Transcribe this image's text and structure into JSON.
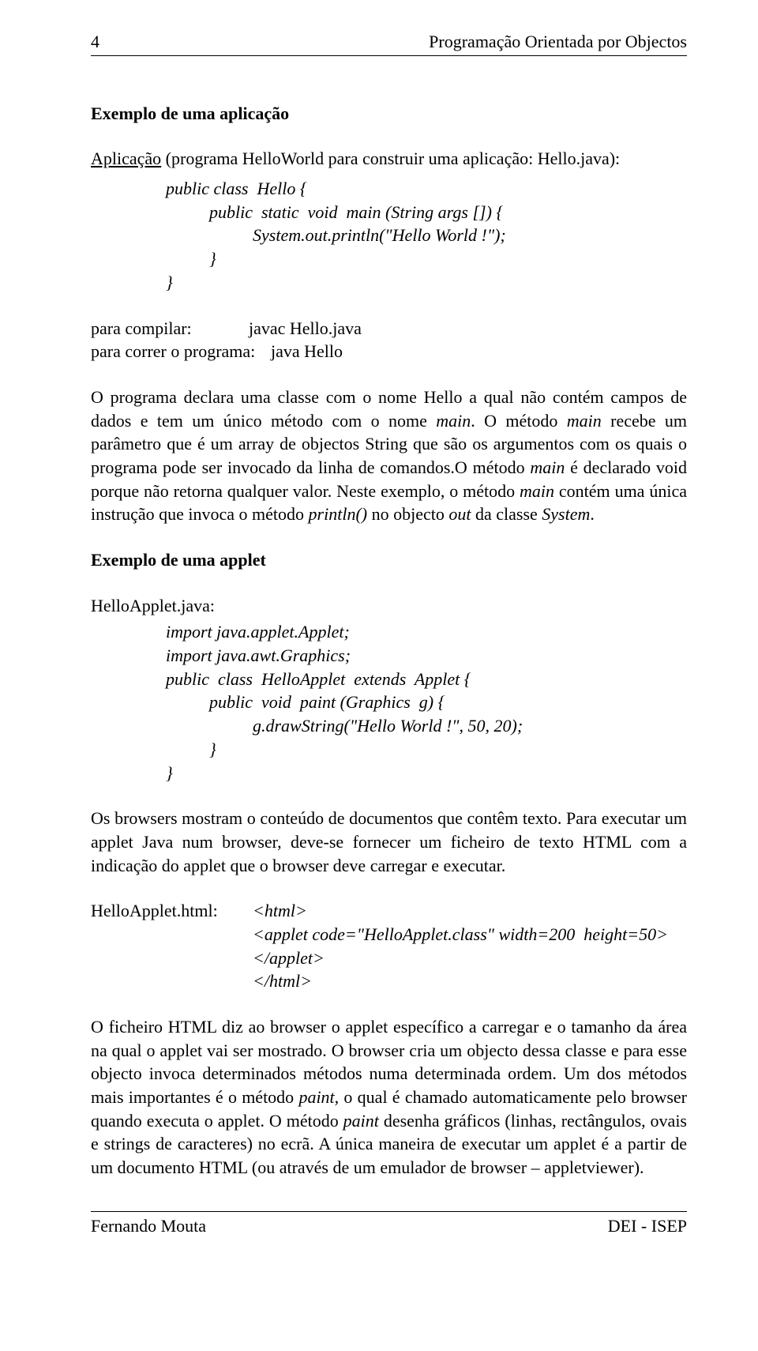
{
  "header": {
    "page_number": "4",
    "title": "Programação Orientada por Objectos"
  },
  "section1": {
    "heading": "Exemplo de uma aplicação",
    "subtitle_underlined": "Aplicação",
    "subtitle_rest": " (programa HelloWorld para construir uma aplicação: Hello.java):",
    "code": {
      "l1": "public class  Hello {",
      "l2": "          public  static  void  main (String args []) {",
      "l3": "                    System.out.println(\"Hello World !\");",
      "l4": "          }",
      "l5": "}"
    },
    "compile_label": "para compilar:",
    "compile_cmd": "javac  Hello.java",
    "run_label": "para correr o programa:",
    "run_cmd": "java  Hello",
    "para1_part1": "O programa declara uma classe com o nome Hello a qual não contém campos de dados e tem um único método com o nome ",
    "para1_italic1": "main",
    "para1_part2": ". O método ",
    "para1_italic2": "main",
    "para1_part3": " recebe um parâmetro que é um array de objectos String que são os argumentos com os quais o programa pode ser invocado da linha de comandos.O método ",
    "para1_italic3": "main",
    "para1_part4": " é declarado void porque não retorna qualquer valor. Neste exemplo, o método ",
    "para1_italic4": "main",
    "para1_part5": " contém uma única instrução que invoca o método ",
    "para1_italic5": "println()",
    "para1_part6": " no objecto ",
    "para1_italic6": "out",
    "para1_part7": " da classe ",
    "para1_italic7": "System",
    "para1_part8": "."
  },
  "section2": {
    "heading": "Exemplo de uma applet",
    "filename": "HelloApplet.java:",
    "code": {
      "l1": "import java.applet.Applet;",
      "l2": "import java.awt.Graphics;",
      "l3": "public  class  HelloApplet  extends  Applet {",
      "l4": "          public  void  paint (Graphics  g) {",
      "l5": "                    g.drawString(\"Hello World !\", 50, 20);",
      "l6": "          }",
      "l7": "}"
    },
    "para2": "Os browsers mostram o conteúdo de documentos que contêm texto. Para executar um applet Java num browser, deve-se fornecer um ficheiro de texto HTML com a indicação do applet que o browser deve carregar e executar.",
    "html_label": "HelloApplet.html:",
    "html_code": {
      "l1": "<html>",
      "l2": "<applet code=\"HelloApplet.class\" width=200  height=50>",
      "l3": "</applet>",
      "l4": "</html>"
    },
    "para3_part1": "O ficheiro HTML diz ao browser o applet específico a carregar e o tamanho da área na qual o applet vai ser mostrado. O browser cria um objecto dessa classe e para esse objecto invoca determinados métodos numa determinada ordem. Um dos métodos mais importantes é o método ",
    "para3_italic1": "paint",
    "para3_part2": ", o qual é chamado automaticamente pelo browser quando executa o applet. O método ",
    "para3_italic2": "paint",
    "para3_part3": " desenha gráficos (linhas, rectângulos, ovais e strings de caracteres) no ecrã. A única maneira de executar um applet é a partir de um documento HTML (ou através de um emulador de browser – appletviewer)."
  },
  "footer": {
    "left": "Fernando Mouta",
    "right": "DEI - ISEP"
  }
}
